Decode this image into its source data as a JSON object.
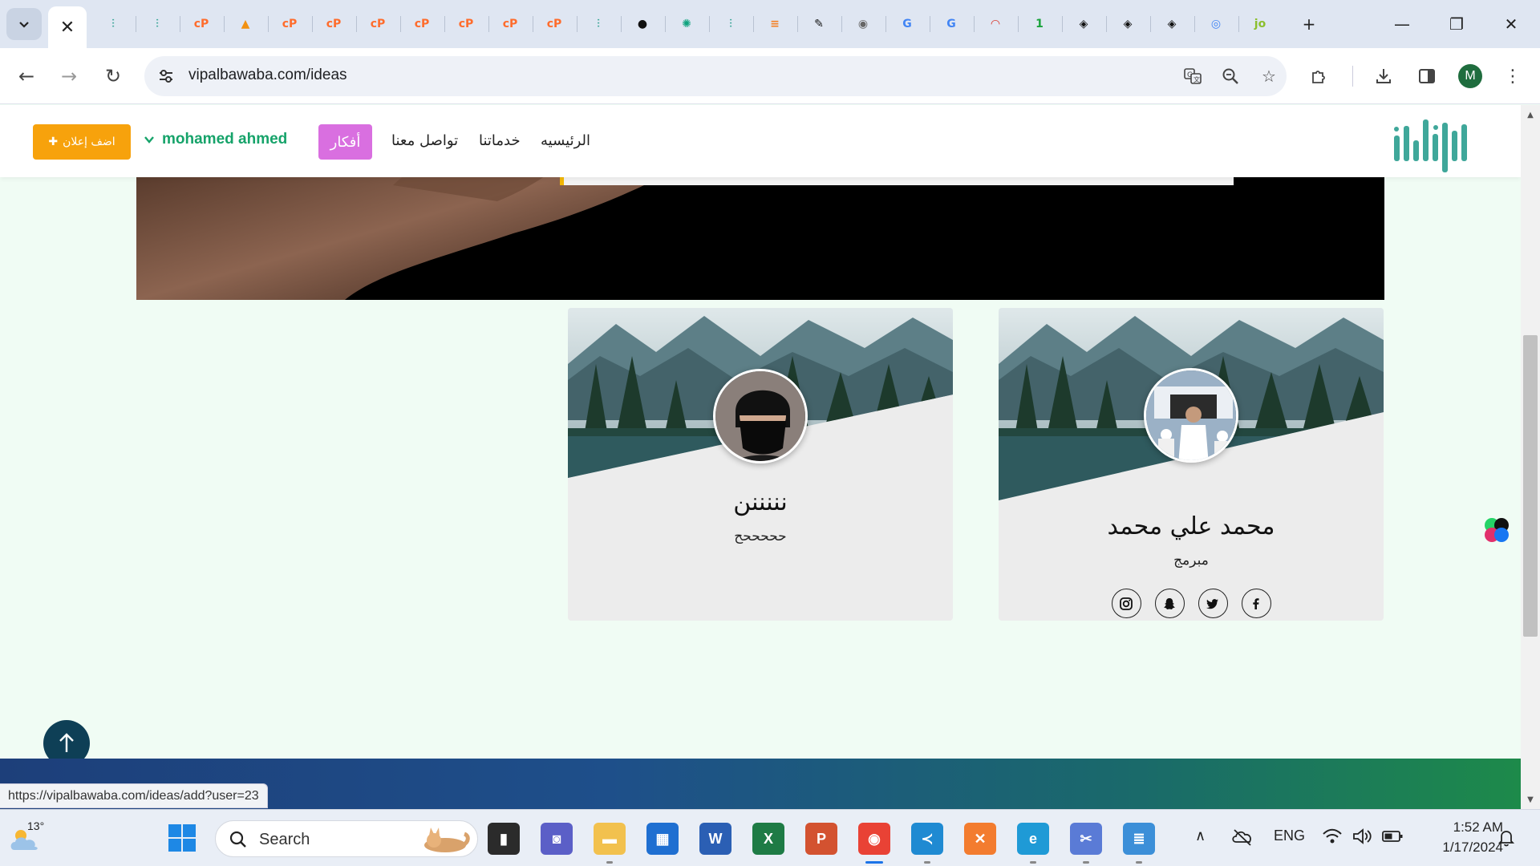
{
  "browser": {
    "url": "vipalbawaba.com/ideas",
    "profile_initial": "M",
    "status_url": "https://vipalbawaba.com/ideas/add?user=23",
    "tabs": [
      {
        "icon": "site-logo-icon",
        "color": "#3fa79a"
      },
      {
        "icon": "site-logo-icon",
        "color": "#3fa79a"
      },
      {
        "icon": "cpanel-icon",
        "color": "#ff6c2c"
      },
      {
        "icon": "phpmyadmin-icon",
        "color": "#f29111"
      },
      {
        "icon": "cpanel-icon",
        "color": "#ff6c2c"
      },
      {
        "icon": "cpanel-icon",
        "color": "#ff6c2c"
      },
      {
        "icon": "cpanel-icon",
        "color": "#ff6c2c"
      },
      {
        "icon": "cpanel-icon",
        "color": "#ff6c2c"
      },
      {
        "icon": "cpanel-icon",
        "color": "#ff6c2c"
      },
      {
        "icon": "cpanel-icon",
        "color": "#ff6c2c"
      },
      {
        "icon": "cpanel-icon",
        "color": "#ff6c2c"
      },
      {
        "icon": "site-logo-icon",
        "color": "#3fa79a"
      },
      {
        "icon": "github-icon",
        "color": "#111111"
      },
      {
        "icon": "chatgpt-icon",
        "color": "#10a37f"
      },
      {
        "icon": "site-logo-icon",
        "color": "#3fa79a"
      },
      {
        "icon": "stackoverflow-icon",
        "color": "#f48024"
      },
      {
        "icon": "edit-app-icon",
        "color": "#111111"
      },
      {
        "icon": "globe-icon",
        "color": "#666666"
      },
      {
        "icon": "google-icon",
        "color": "#4285f4"
      },
      {
        "icon": "google-icon",
        "color": "#4285f4"
      },
      {
        "icon": "speedometer-icon",
        "color": "#d93025"
      },
      {
        "icon": "one-icon",
        "color": "#1aa33c"
      },
      {
        "icon": "codepen-icon",
        "color": "#111111"
      },
      {
        "icon": "codepen-icon",
        "color": "#111111"
      },
      {
        "icon": "codepen-icon",
        "color": "#111111"
      },
      {
        "icon": "google-lens-icon",
        "color": "#4285f4"
      },
      {
        "icon": "jo-icon",
        "color": "#8bbf2d"
      }
    ]
  },
  "site": {
    "add_ad_label": "اضف إعلان",
    "user_name": "mohamed ahmed",
    "ideas_label": "أفكار",
    "nav": {
      "contact": "تواصل معنا",
      "services": "خدماتنا",
      "home": "الرئيسيه"
    },
    "accent_colors": {
      "add_ad": "#f7a20c",
      "ideas": "#d96fe0",
      "user": "#16a36a"
    }
  },
  "cards": [
    {
      "name": "محمد علي محمد",
      "role": "مبرمج",
      "socials": [
        "instagram-icon",
        "snapchat-icon",
        "twitter-icon",
        "facebook-icon"
      ]
    },
    {
      "name": "نننننن",
      "role": "حححححح",
      "socials": []
    }
  ],
  "taskbar": {
    "weather_temp": "13°",
    "search_placeholder": "Search",
    "language": "ENG",
    "time": "1:52 AM",
    "date": "1/17/2024",
    "apps": [
      "task-view-icon",
      "teams-chat-icon",
      "file-explorer-icon",
      "microsoft-store-icon",
      "word-icon",
      "excel-icon",
      "powerpoint-icon",
      "chrome-icon",
      "vscode-icon",
      "xampp-icon",
      "edge-icon",
      "snipping-tool-icon",
      "notepad-icon"
    ]
  }
}
